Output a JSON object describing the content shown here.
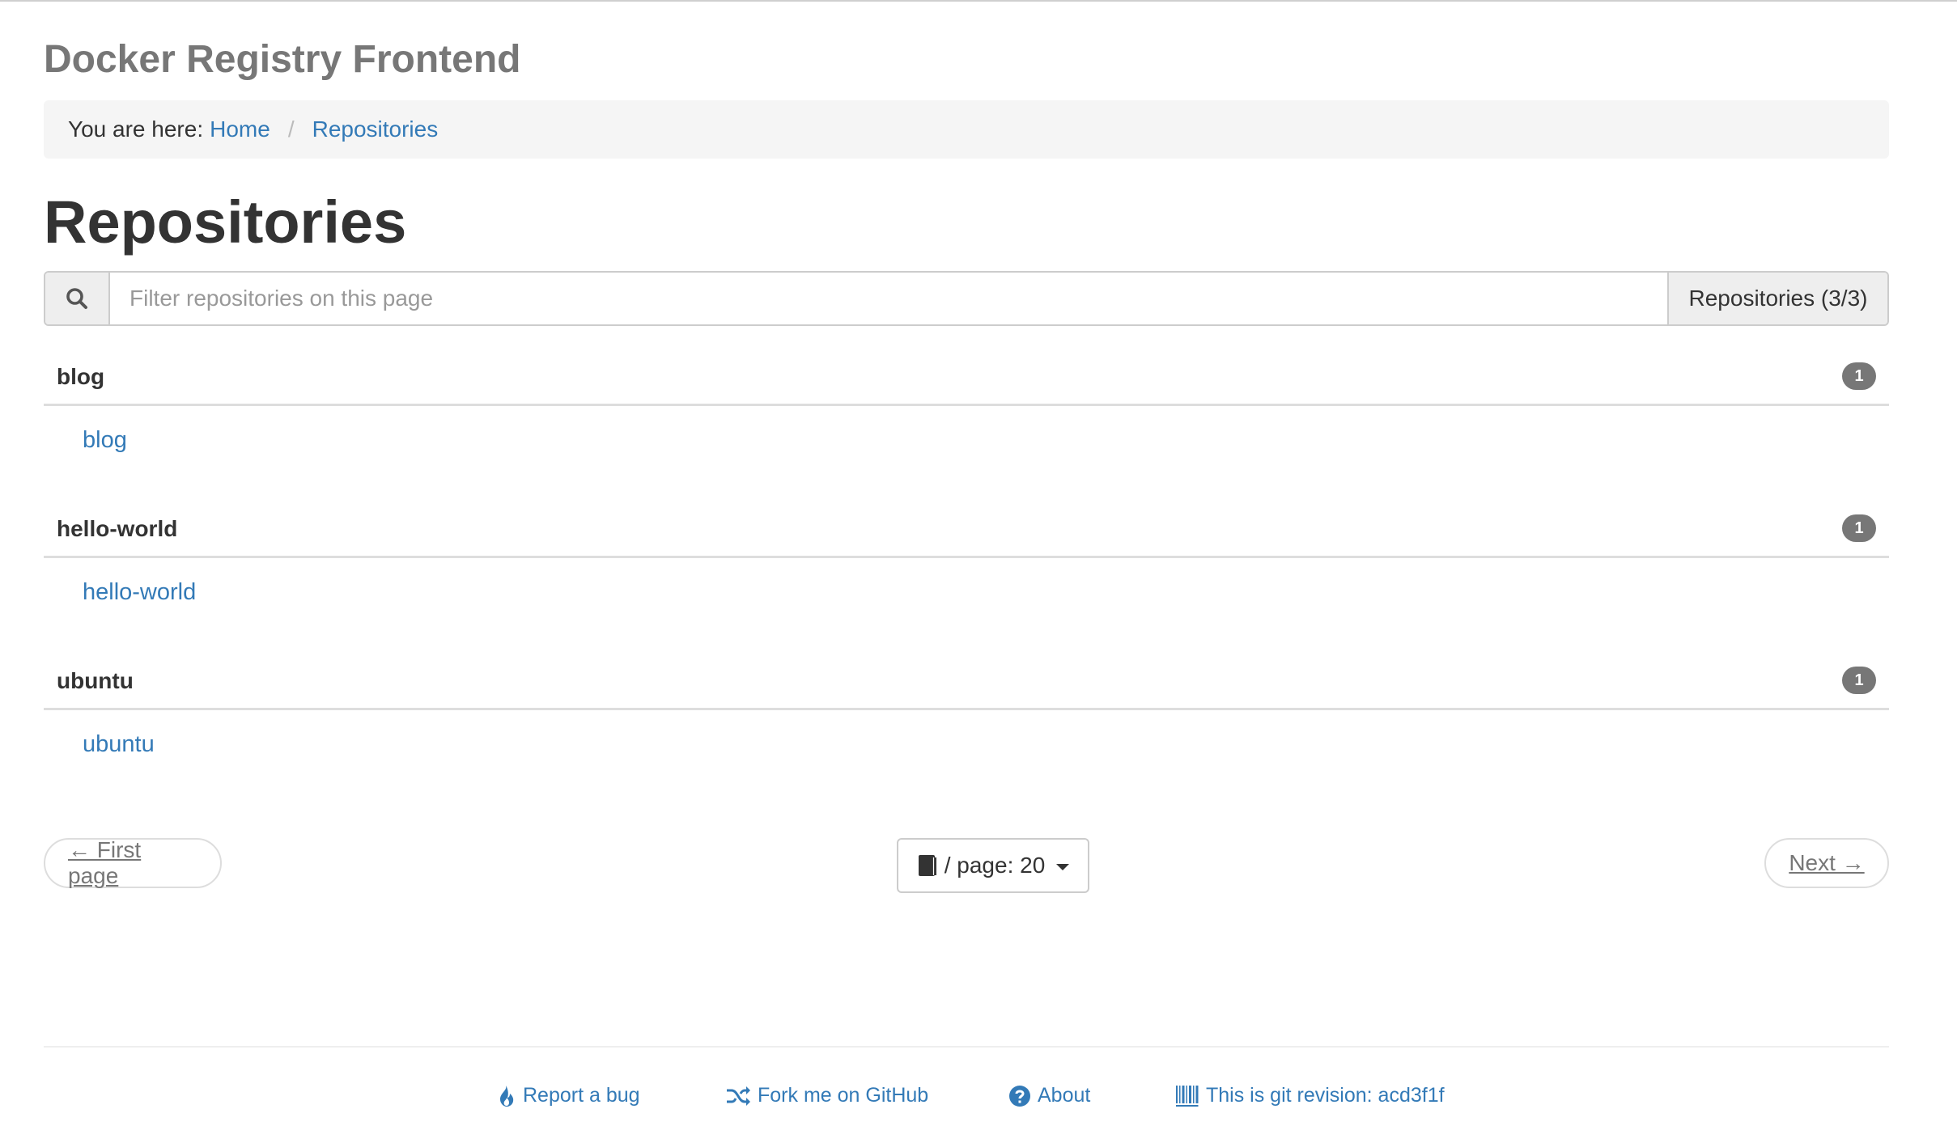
{
  "app": {
    "title": "Docker Registry Frontend"
  },
  "breadcrumb": {
    "prefix": "You are here:",
    "items": [
      {
        "label": "Home"
      },
      {
        "label": "Repositories"
      }
    ],
    "separator": "/"
  },
  "page": {
    "heading": "Repositories"
  },
  "search": {
    "icon": "search-icon",
    "placeholder": "Filter repositories on this page",
    "value": "",
    "count_label": "Repositories (3/3)"
  },
  "groups": [
    {
      "name": "blog",
      "badge": "1",
      "repos": [
        {
          "label": "blog"
        }
      ]
    },
    {
      "name": "hello-world",
      "badge": "1",
      "repos": [
        {
          "label": "hello-world"
        }
      ]
    },
    {
      "name": "ubuntu",
      "badge": "1",
      "repos": [
        {
          "label": "ubuntu"
        }
      ]
    }
  ],
  "pagination": {
    "first_label": "← First page",
    "next_label": "Next →",
    "per_page_label": "/ page: 20",
    "per_page_icon": "book-icon"
  },
  "footer": {
    "links": [
      {
        "label": "Report a bug",
        "icon": "fire-icon"
      },
      {
        "label": "Fork me on GitHub",
        "icon": "random-icon"
      },
      {
        "label": "About",
        "icon": "question-circle-icon"
      },
      {
        "label": "This is git revision: acd3f1f",
        "icon": "barcode-icon"
      }
    ]
  },
  "colors": {
    "link": "#337ab7",
    "badge": "#777777",
    "breadcrumb_bg": "#f5f5f5",
    "title": "#777777"
  }
}
